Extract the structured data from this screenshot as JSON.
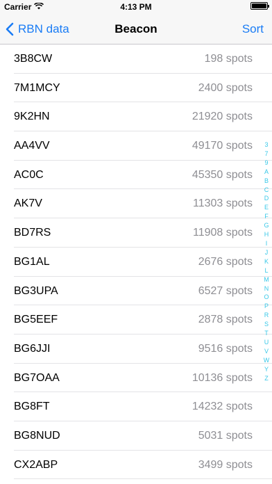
{
  "status": {
    "carrier": "Carrier",
    "time": "4:13 PM"
  },
  "nav": {
    "back_label": "RBN data",
    "title": "Beacon",
    "sort_label": "Sort"
  },
  "rows": [
    {
      "call": "3B8CW",
      "spots": "198 spots"
    },
    {
      "call": "7M1MCY",
      "spots": "2400 spots"
    },
    {
      "call": "9K2HN",
      "spots": "21920 spots"
    },
    {
      "call": "AA4VV",
      "spots": "49170 spots"
    },
    {
      "call": "AC0C",
      "spots": "45350 spots"
    },
    {
      "call": "AK7V",
      "spots": "11303 spots"
    },
    {
      "call": "BD7RS",
      "spots": "11908 spots"
    },
    {
      "call": "BG1AL",
      "spots": "2676 spots"
    },
    {
      "call": "BG3UPA",
      "spots": "6527 spots"
    },
    {
      "call": "BG5EEF",
      "spots": "2878 spots"
    },
    {
      "call": "BG6JJI",
      "spots": "9516 spots"
    },
    {
      "call": "BG7OAA",
      "spots": "10136 spots"
    },
    {
      "call": "BG8FT",
      "spots": "14232 spots"
    },
    {
      "call": "BG8NUD",
      "spots": "5031 spots"
    },
    {
      "call": "CX2ABP",
      "spots": "3499 spots"
    }
  ],
  "index": [
    "3",
    "7",
    "9",
    "A",
    "B",
    "C",
    "D",
    "E",
    "F",
    "G",
    "H",
    "I",
    "J",
    "K",
    "L",
    "M",
    "N",
    "O",
    "P",
    "R",
    "S",
    "T",
    "U",
    "V",
    "W",
    "Y",
    "Z"
  ],
  "colors": {
    "accent": "#1a7cf5",
    "index": "#38c8e8",
    "secondary_text": "#8e8e93"
  }
}
